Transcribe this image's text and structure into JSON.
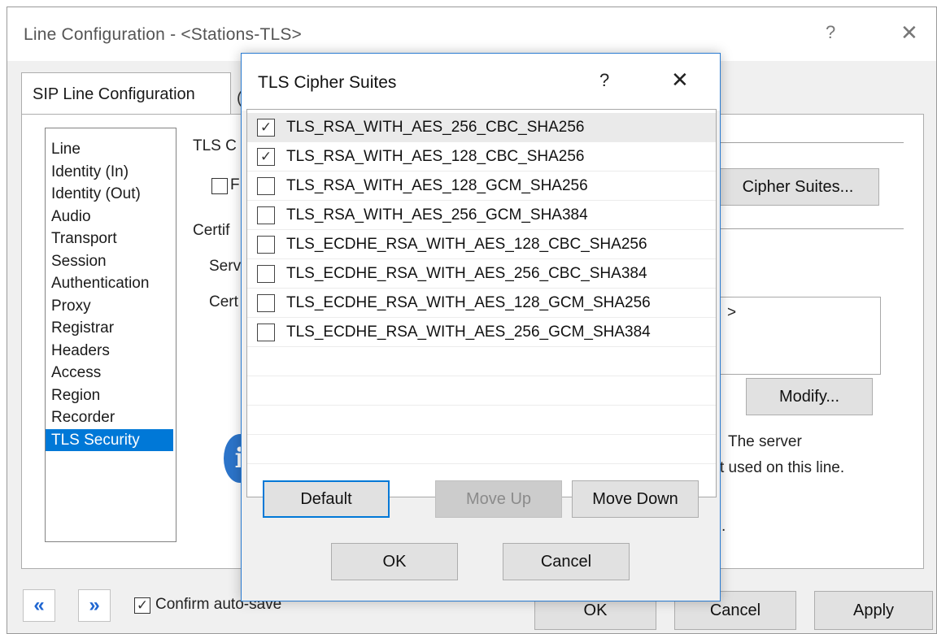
{
  "window": {
    "title": "Line Configuration - <Stations-TLS>",
    "help": "?",
    "close": "✕"
  },
  "tabs": {
    "active": "SIP Line Configuration",
    "next_fragment": "("
  },
  "sidebar": {
    "items": [
      {
        "label": "Line"
      },
      {
        "label": "Identity (In)"
      },
      {
        "label": "Identity (Out)"
      },
      {
        "label": "Audio"
      },
      {
        "label": "Transport"
      },
      {
        "label": "Session"
      },
      {
        "label": "Authentication"
      },
      {
        "label": "Proxy"
      },
      {
        "label": "Registrar"
      },
      {
        "label": "Headers"
      },
      {
        "label": "Access"
      },
      {
        "label": "Region"
      },
      {
        "label": "Recorder"
      },
      {
        "label": "TLS Security",
        "selected": true
      }
    ]
  },
  "background": {
    "tls_heading_fragment": "TLS C",
    "checkbox_label_fragment": "F",
    "cert_heading_fragment": "Certif",
    "server_fragment": "Serv",
    "cert_fragment": "Cert",
    "cipher_suites_button": "Cipher Suites...",
    "cert_value_fragment": ">",
    "modify_button": "Modify...",
    "info_line1": "The server",
    "info_line2": "t used on this line.",
    "dot": "."
  },
  "footer": {
    "prev_icon": "«",
    "next_icon": "»",
    "confirm_autosave_label": "Confirm auto-save",
    "confirm_autosave_checked": true,
    "ok_button": "OK",
    "cancel_button": "Cancel",
    "apply_button": "Apply"
  },
  "modal": {
    "title": "TLS Cipher Suites",
    "help": "?",
    "close": "✕",
    "ciphers": [
      {
        "name": "TLS_RSA_WITH_AES_256_CBC_SHA256",
        "checked": true
      },
      {
        "name": "TLS_RSA_WITH_AES_128_CBC_SHA256",
        "checked": true
      },
      {
        "name": "TLS_RSA_WITH_AES_128_GCM_SHA256",
        "checked": false
      },
      {
        "name": "TLS_RSA_WITH_AES_256_GCM_SHA384",
        "checked": false
      },
      {
        "name": "TLS_ECDHE_RSA_WITH_AES_128_CBC_SHA256",
        "checked": false
      },
      {
        "name": "TLS_ECDHE_RSA_WITH_AES_256_CBC_SHA384",
        "checked": false
      },
      {
        "name": "TLS_ECDHE_RSA_WITH_AES_128_GCM_SHA256",
        "checked": false
      },
      {
        "name": "TLS_ECDHE_RSA_WITH_AES_256_GCM_SHA384",
        "checked": false
      }
    ],
    "default_button": "Default",
    "move_up_button": "Move Up",
    "move_down_button": "Move Down",
    "ok_button": "OK",
    "cancel_button": "Cancel"
  },
  "colors": {
    "selection": "#0078d7",
    "nav_arrow": "#1f66d1",
    "modal_border": "#2a7bd1"
  }
}
